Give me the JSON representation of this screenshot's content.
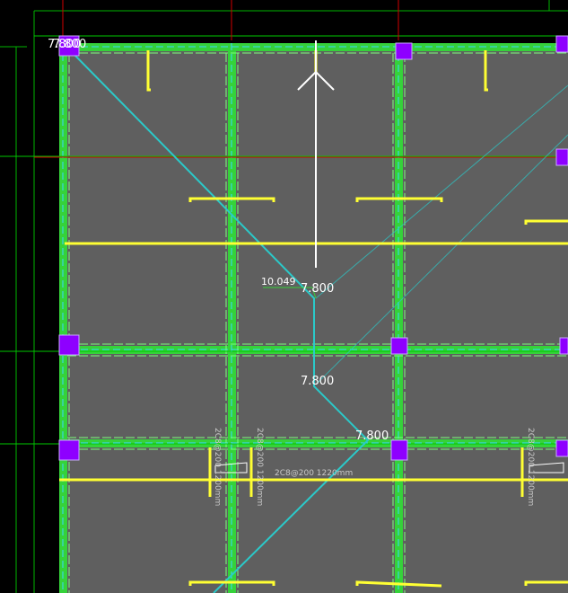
{
  "colors": {
    "background": "#000000",
    "slab": "#5f5f5f",
    "beam": "#35d23a",
    "beam_dash": "#3bd6ff",
    "column": "#8e00ff",
    "rebar": "#ffff33",
    "grid_green": "#00c800",
    "grid_red": "#d20000",
    "diagonal": "#2bc9c9",
    "text": "#ffffff"
  },
  "elevations": {
    "corner": "7.800",
    "corner_overlap": "7.800",
    "center_upper": "7.800",
    "center_lower": "7.800",
    "junction": "7.800",
    "measure": "10.049"
  },
  "rebar_labels": {
    "vertical_1": "2C8@200 1200mm",
    "vertical_2": "2C8@200 1200mm",
    "horizontal": "2C8@200 1220mm",
    "vertical_3": "2C8@200 1200mm"
  },
  "icons": {
    "arrow": "north-arrow-icon",
    "column": "column-square-icon"
  }
}
